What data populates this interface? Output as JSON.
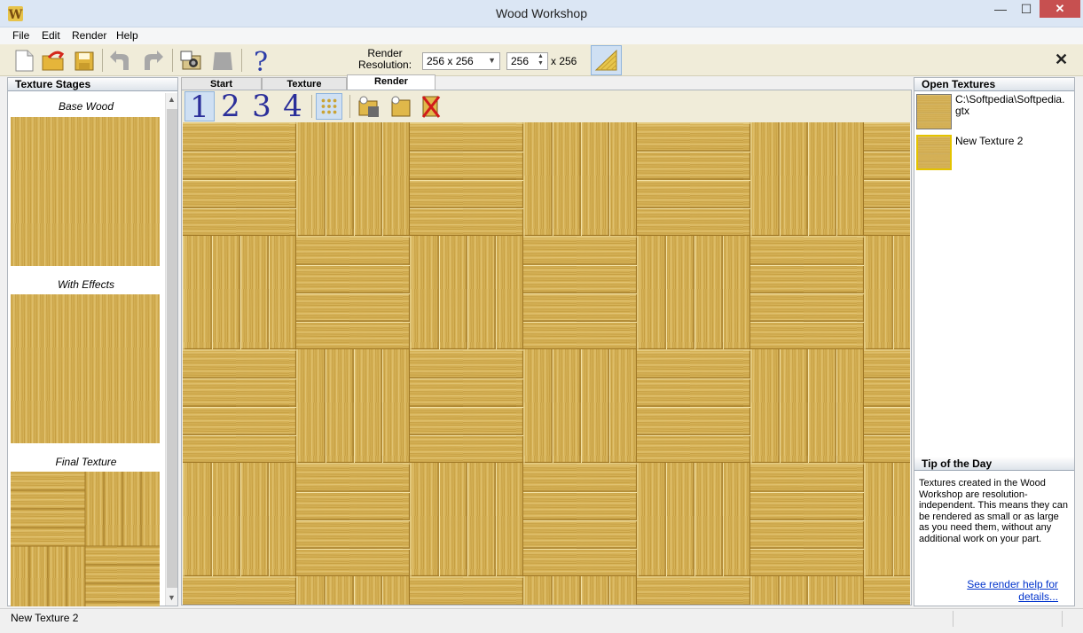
{
  "window": {
    "title": "Wood Workshop"
  },
  "menu": [
    "File",
    "Edit",
    "Render",
    "Help"
  ],
  "toolbar": {
    "resolution_label": "Render Resolution:",
    "resolution_select": "256 x 256",
    "resolution_width": "256",
    "resolution_height_text": "x 256",
    "close_glyph": "✕"
  },
  "left_panel": {
    "header": "Texture Stages",
    "stages": [
      "Base Wood",
      "With Effects",
      "Final Texture"
    ]
  },
  "tabs": [
    {
      "label": "Start",
      "active": false
    },
    {
      "label": "Texture",
      "active": false
    },
    {
      "label": "Render",
      "active": true
    }
  ],
  "center_toolbar": {
    "stage_buttons": [
      "1",
      "2",
      "3",
      "4"
    ],
    "selected_stage": "1"
  },
  "right_panel": {
    "header": "Open Textures",
    "textures": [
      {
        "name": "C:\\Softpedia\\Softpedia.gtx"
      },
      {
        "name": "New Texture 2"
      }
    ],
    "tip_header": "Tip of the Day",
    "tip_text": "Textures created in the Wood Workshop are resolution-independent.  This means they can be rendered as small or as large as you need them, without any additional work on your part.",
    "tip_link": "See render help for details..."
  },
  "status": {
    "text": "New Texture 2"
  },
  "colors": {
    "wood_light": "#d8b65a",
    "wood_dark": "#b98c2c",
    "toolbar_bg": "#f0ecd9",
    "selected_bg": "#cfe0f3",
    "link": "#0033cc"
  }
}
